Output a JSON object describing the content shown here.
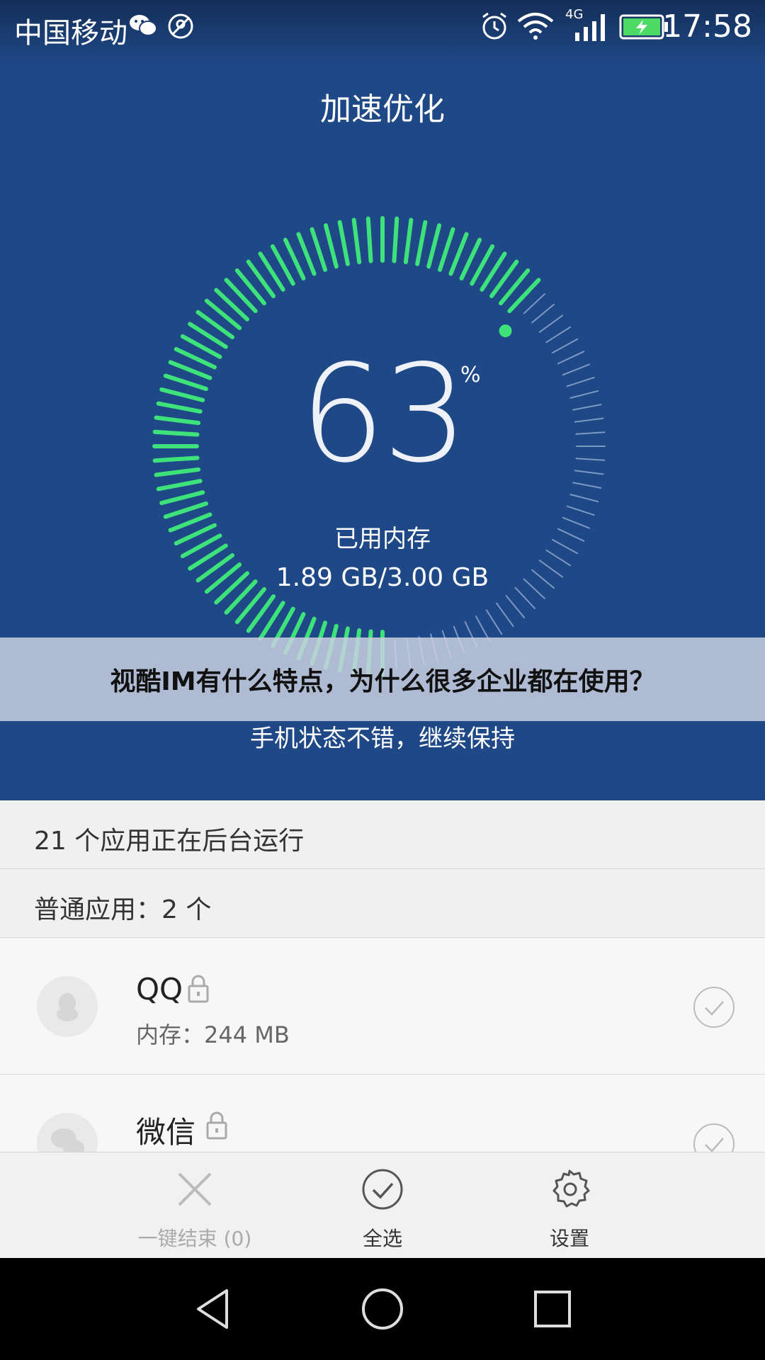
{
  "statusbar": {
    "carrier": "中国移动",
    "network": "4G",
    "time": "17:58",
    "icons": [
      "wechat-icon",
      "location-icon",
      "alarm-icon",
      "wifi-icon",
      "signal-icon",
      "battery-icon"
    ]
  },
  "header": {
    "title": "加速优化"
  },
  "gauge": {
    "percent": "63",
    "unit": "%",
    "used_fraction": 0.63,
    "label": "已用内存",
    "value": "1.89 GB/3.00 GB",
    "active_color": "#3ee27a",
    "inactive_color": "#7d98c3"
  },
  "banner": {
    "text": "视酷IM有什么特点，为什么很多企业都在使用？"
  },
  "status_message": "手机状态不错，继续保持",
  "sections": {
    "running": "21 个应用正在后台运行",
    "normal_apps": "普通应用：2 个"
  },
  "apps": [
    {
      "name": "QQ",
      "memory": "内存：244 MB",
      "icon": "qq-icon"
    },
    {
      "name": "微信",
      "icon": "wechat-icon"
    }
  ],
  "toolbar": {
    "end_all": "一键结束 (0)",
    "select_all": "全选",
    "settings": "设置"
  },
  "colors": {
    "header_bg": "#1e4886",
    "accent_green": "#3ee27a"
  }
}
